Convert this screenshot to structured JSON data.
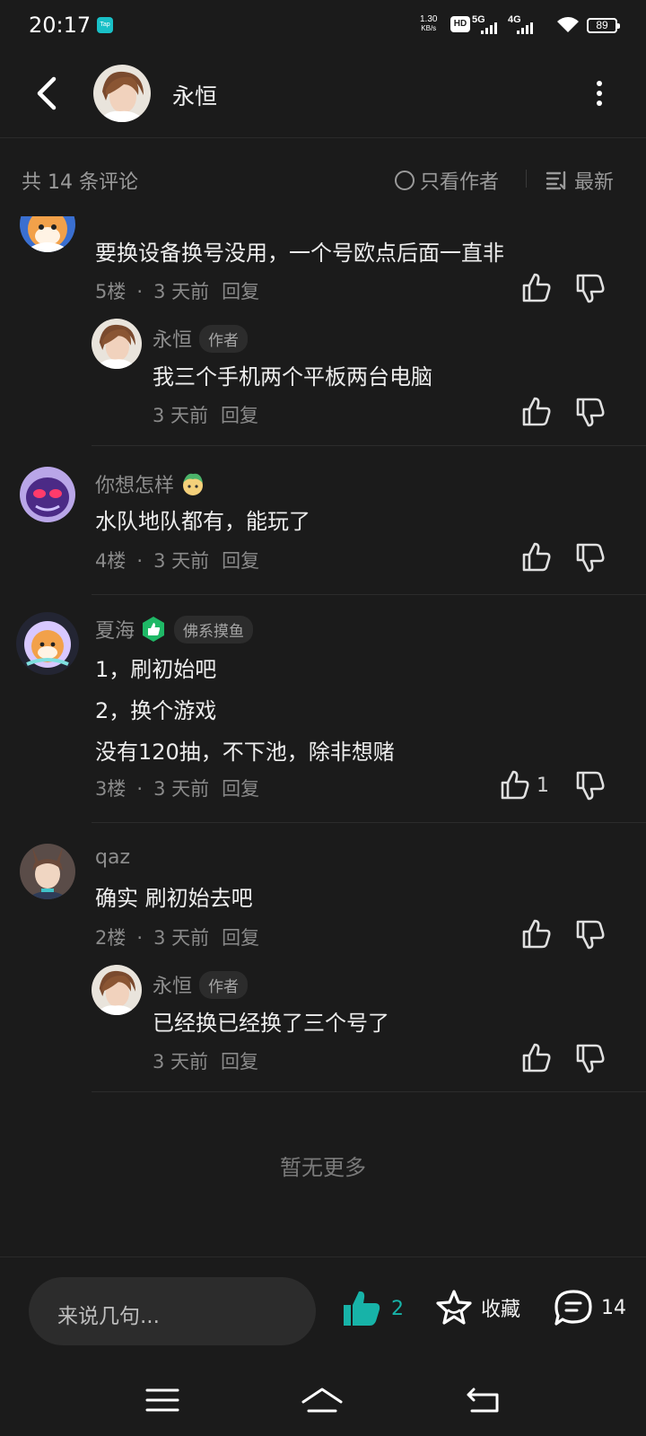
{
  "status_bar": {
    "time": "20:17",
    "app_badge": "Tap",
    "speed_value": "1.30",
    "speed_unit": "KB/s",
    "hd_label": "HD",
    "sim1_label": "5G",
    "sim2_label": "4G",
    "battery": "89"
  },
  "header": {
    "title": "永恒"
  },
  "filter": {
    "count_label": "共 14 条评论",
    "only_author": "只看作者",
    "sort_label": "最新"
  },
  "comments": [
    {
      "text": "要换设备换号没用，一个号欧点后面一直非",
      "floor": "5楼",
      "time": "3 天前",
      "reply": "回复",
      "replies": [
        {
          "user": "永恒",
          "tag": "作者",
          "text": "我三个手机两个平板两台电脑",
          "time": "3 天前",
          "reply": "回复"
        }
      ]
    },
    {
      "user": "你想怎样",
      "text": "水队地队都有，能玩了",
      "floor": "4楼",
      "time": "3 天前",
      "reply": "回复"
    },
    {
      "user": "夏海",
      "tag": "佛系摸鱼",
      "lines": [
        "1，刷初始吧",
        "2，换个游戏",
        "没有120抽，不下池，除非想赌"
      ],
      "floor": "3楼",
      "time": "3 天前",
      "reply": "回复",
      "likes": "1"
    },
    {
      "user": "qaz",
      "text": "确实 刷初始去吧",
      "floor": "2楼",
      "time": "3 天前",
      "reply": "回复",
      "replies": [
        {
          "user": "永恒",
          "tag": "作者",
          "text": "已经换已经换了三个号了",
          "time": "3 天前",
          "reply": "回复"
        }
      ]
    }
  ],
  "no_more": "暂无更多",
  "bottom_bar": {
    "input_placeholder": "来说几句...",
    "like_count": "2",
    "favorite_label": "收藏",
    "comment_count": "14"
  },
  "colors": {
    "background": "#1b1b1b",
    "accent": "#17b3a8",
    "badge_green": "#1fb866"
  },
  "icons": [
    "back-arrow-icon",
    "more-vertical-icon",
    "radio-icon",
    "sort-icon",
    "thumbs-up-icon",
    "thumbs-down-icon",
    "star-icon",
    "comment-icon",
    "menu-icon",
    "home-icon",
    "back-icon"
  ]
}
